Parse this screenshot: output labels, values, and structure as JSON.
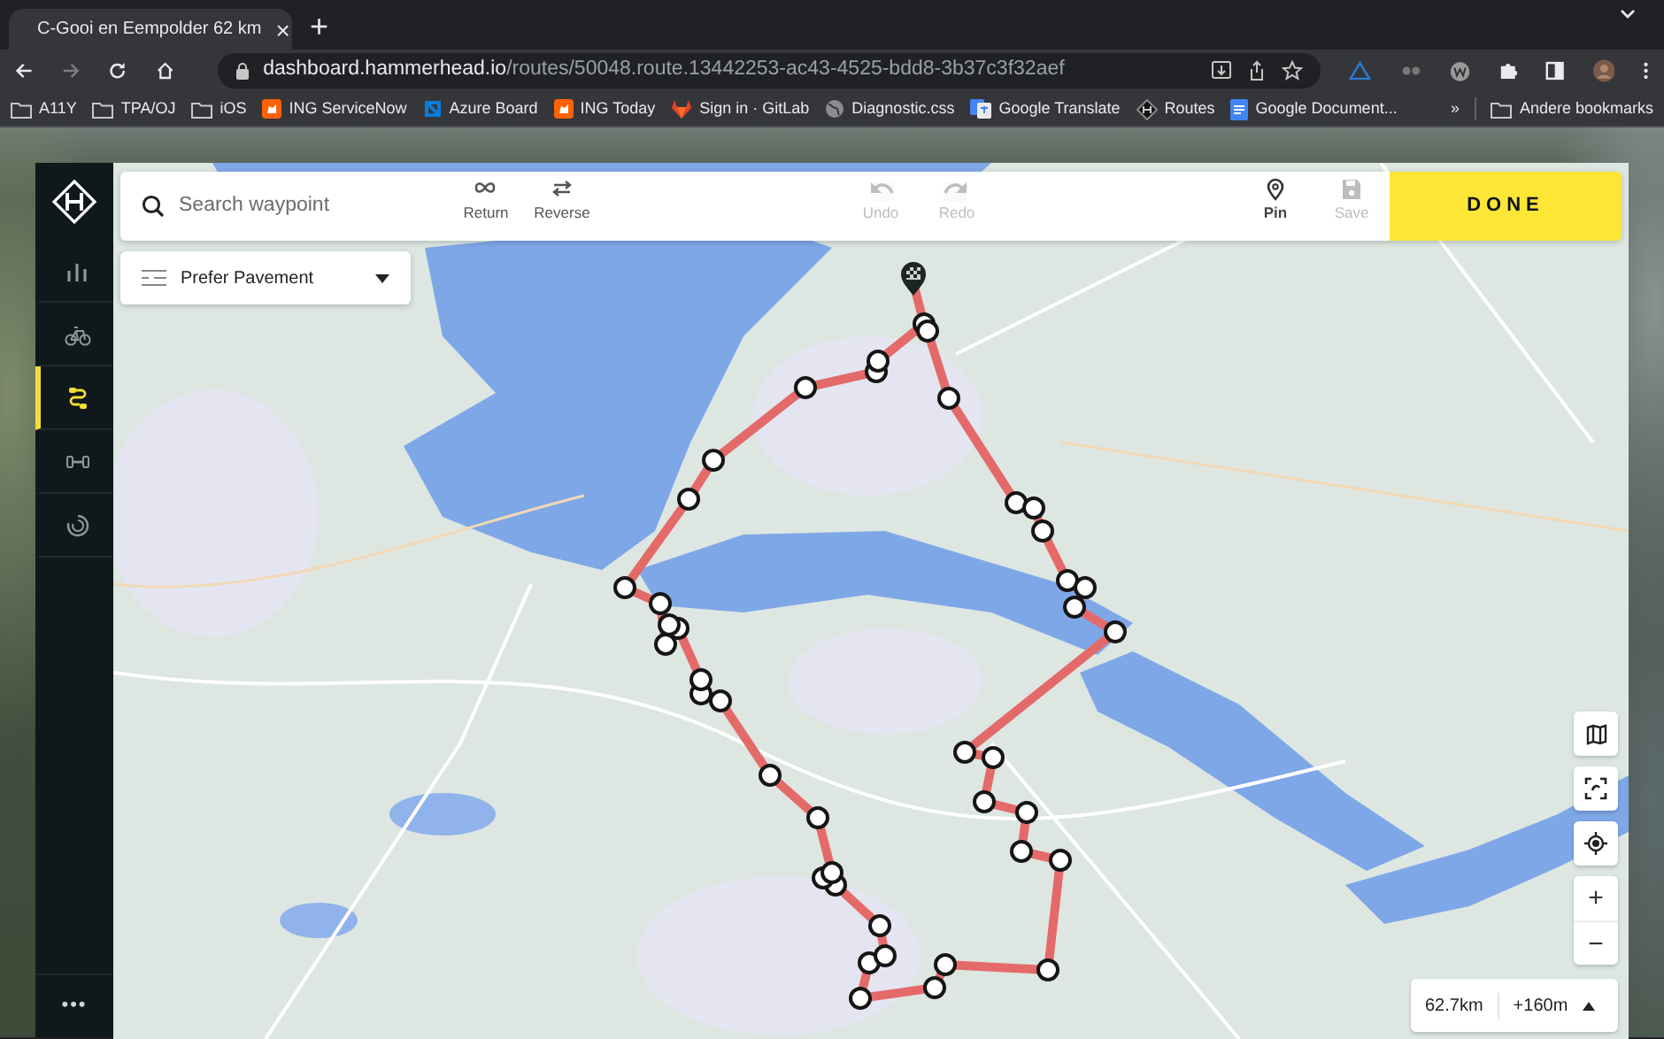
{
  "browser": {
    "tab": {
      "title": "C-Gooi en Eempolder 62 km",
      "close": "×"
    },
    "new_tab": "+",
    "url": {
      "domain": "dashboard.hammerhead.io",
      "path": "/routes/50048.route.13442253-ac43-4525-bdd8-3b37c3f32aef"
    },
    "bookmarks": [
      {
        "label": "A11Y",
        "kind": "folder"
      },
      {
        "label": "TPA/OJ",
        "kind": "folder"
      },
      {
        "label": "iOS",
        "kind": "folder"
      },
      {
        "label": "ING ServiceNow",
        "kind": "ing"
      },
      {
        "label": "Azure Board",
        "kind": "azure"
      },
      {
        "label": "ING Today",
        "kind": "ing"
      },
      {
        "label": "Sign in · GitLab",
        "kind": "gitlab"
      },
      {
        "label": "Diagnostic.css",
        "kind": "globe"
      },
      {
        "label": "Google Translate",
        "kind": "translate"
      },
      {
        "label": "Routes",
        "kind": "hammerhead"
      },
      {
        "label": "Google Document...",
        "kind": "docs"
      }
    ],
    "bookmarks_overflow": "»",
    "other_bookmarks": "Andere bookmarks"
  },
  "sidebar": {
    "items": [
      {
        "kind": "stats",
        "selected": false
      },
      {
        "kind": "bike",
        "selected": false
      },
      {
        "kind": "routes",
        "selected": true
      },
      {
        "kind": "workouts",
        "selected": false
      },
      {
        "kind": "progress",
        "selected": false
      }
    ],
    "more": "•••"
  },
  "toolbar": {
    "search": {
      "placeholder": "Search waypoint"
    },
    "action_groups": [
      {
        "actions": [
          {
            "label": "Return",
            "kind": "return",
            "disabled": false
          },
          {
            "label": "Reverse",
            "kind": "reverse",
            "disabled": false
          }
        ]
      },
      {
        "actions": [
          {
            "label": "Undo",
            "kind": "undo",
            "disabled": true
          },
          {
            "label": "Redo",
            "kind": "redo",
            "disabled": true
          }
        ]
      },
      {
        "actions": [
          {
            "label": "Pin",
            "kind": "pin",
            "disabled": false
          },
          {
            "label": "Save",
            "kind": "save",
            "disabled": true
          }
        ]
      }
    ],
    "done": "DONE"
  },
  "preference": {
    "label": "Prefer Pavement"
  },
  "zoom": {
    "in": "+",
    "out": "−"
  },
  "route_stats": {
    "distance": "62.7km",
    "elevation": "+160m"
  }
}
